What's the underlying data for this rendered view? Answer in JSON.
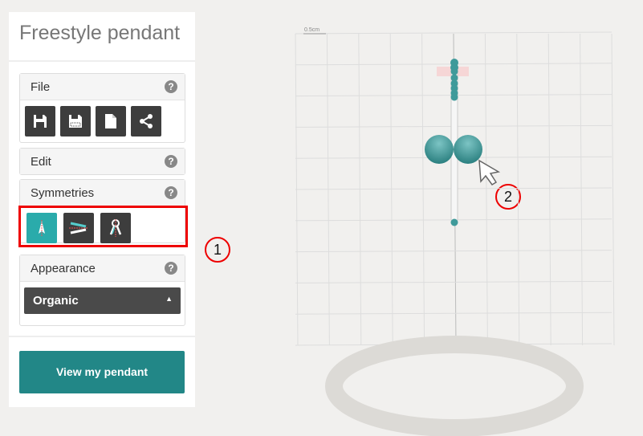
{
  "title": "Freestyle pendant",
  "sections": {
    "file": {
      "label": "File",
      "help": "?",
      "buttons": [
        "save-icon",
        "save-as-icon",
        "new-file-icon",
        "share-icon"
      ]
    },
    "edit": {
      "label": "Edit",
      "help": "?"
    },
    "symmetries": {
      "label": "Symmetries",
      "help": "?",
      "buttons": [
        "vertical-symmetry-icon",
        "horizontal-symmetry-icon",
        "radial-symmetry-icon"
      ],
      "active": 0
    },
    "appearance": {
      "label": "Appearance",
      "help": "?",
      "selected": "Organic"
    }
  },
  "view_button": "View my pendant",
  "viewport": {
    "scale_label": "0.5cm"
  },
  "annotations": [
    "1",
    "2"
  ],
  "colors": {
    "accent": "#228787",
    "active": "#2aabab",
    "bead": "#3f9a9a",
    "highlight": "#e00000"
  }
}
